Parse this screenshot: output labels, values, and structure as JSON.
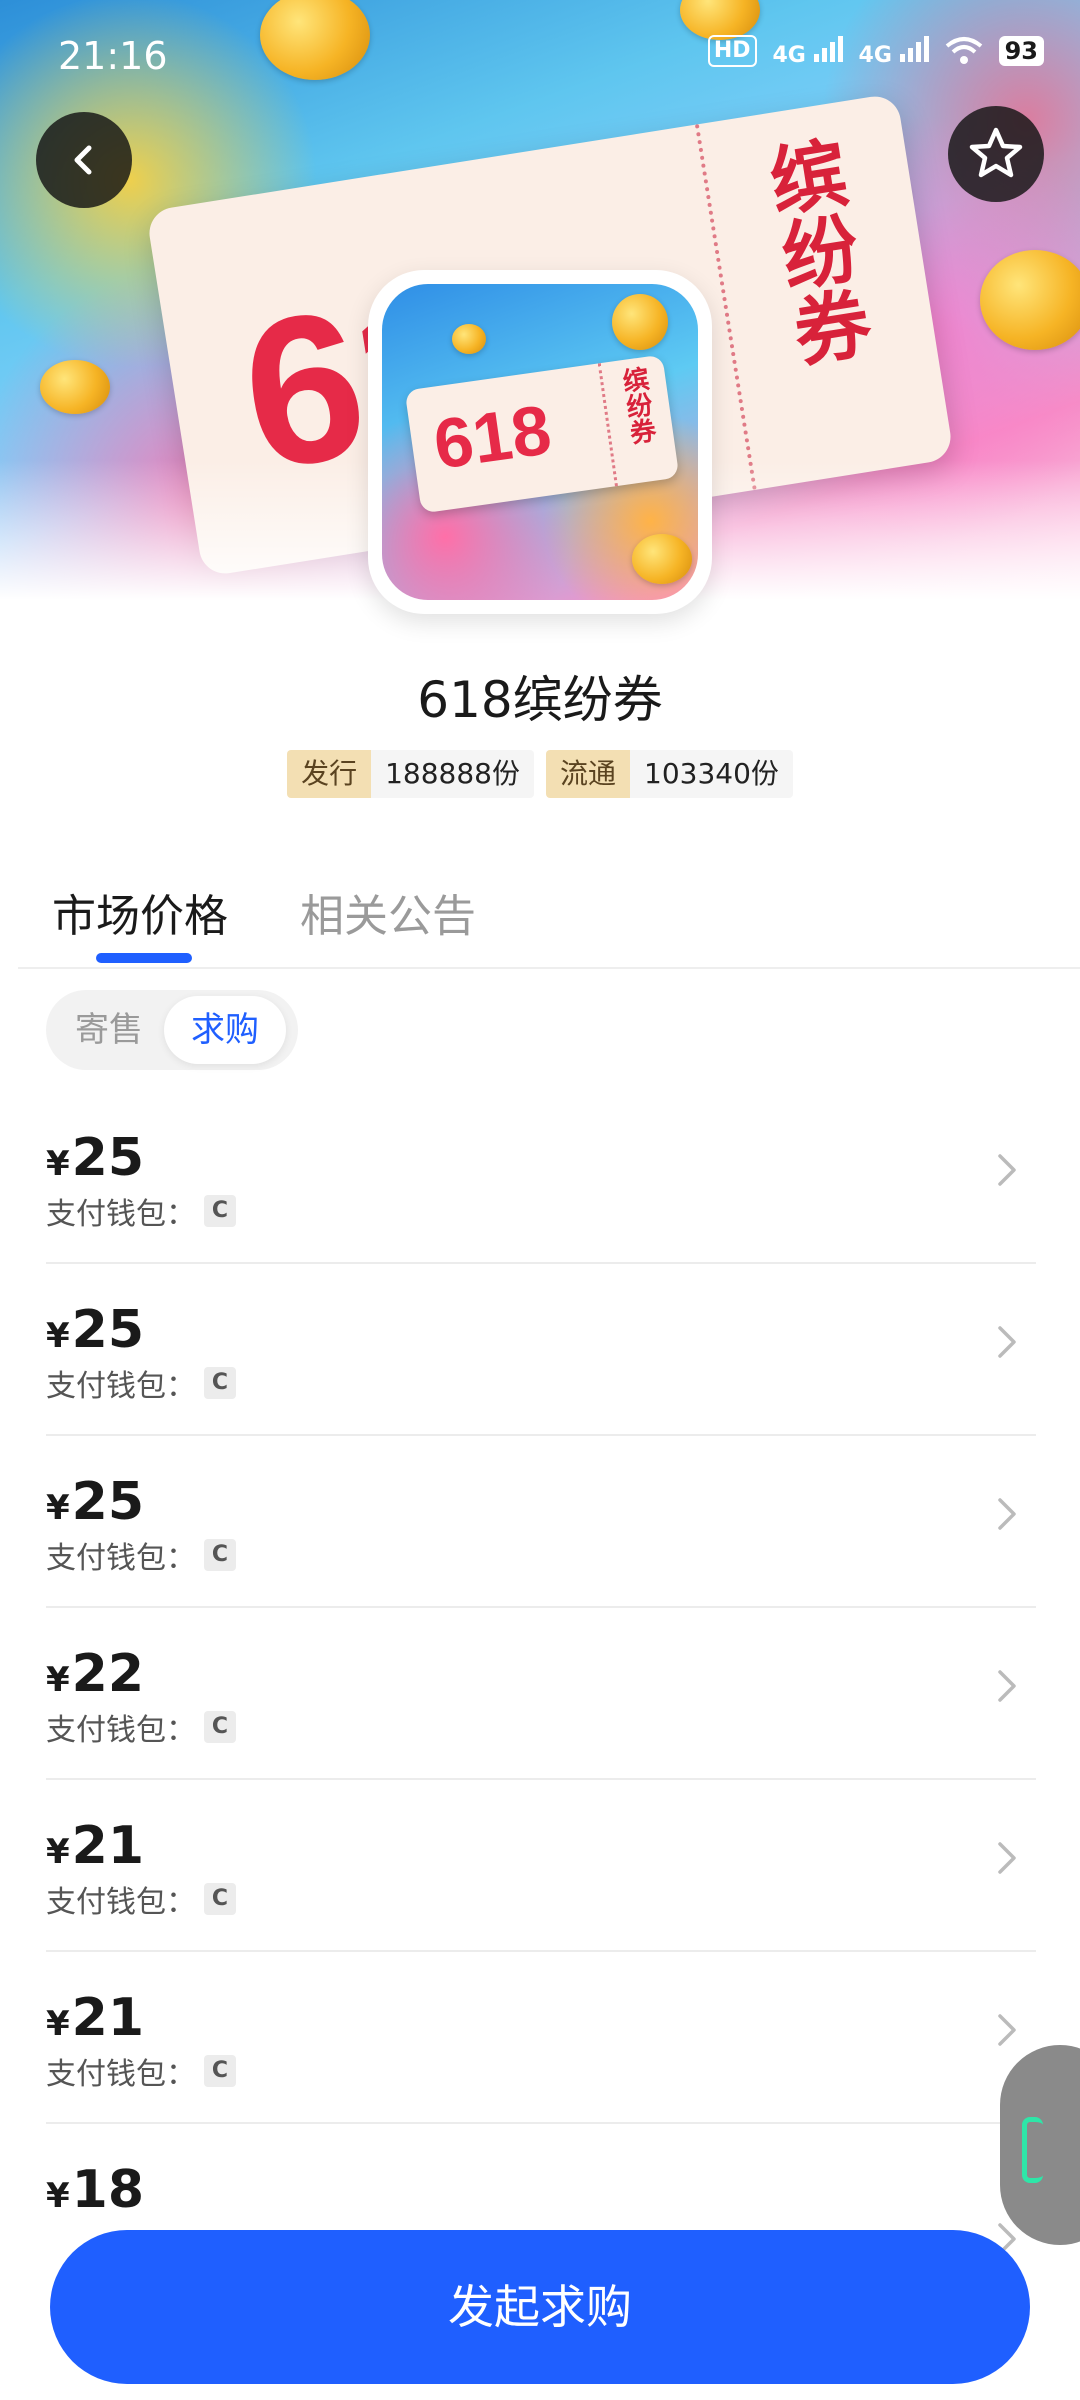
{
  "status_bar": {
    "time": "21:16",
    "hd_label": "HD",
    "net1": "4G",
    "net2": "4G",
    "battery": "93"
  },
  "hero": {
    "ticket_number": "618",
    "ticket_stub_text": "缤纷券"
  },
  "logo": {
    "ticket_number": "618",
    "stub_text": "缤纷券"
  },
  "product": {
    "title": "618缤纷券",
    "badges": [
      {
        "key": "发行",
        "value": "188888份"
      },
      {
        "key": "流通",
        "value": "103340份"
      }
    ]
  },
  "tabs": [
    {
      "label": "市场价格",
      "active": true
    },
    {
      "label": "相关公告",
      "active": false
    }
  ],
  "segment": {
    "options": [
      "寄售",
      "求购"
    ],
    "selected": "求购"
  },
  "listings": [
    {
      "currency": "¥",
      "price": "25",
      "wallet_label": "支付钱包：",
      "wallet_chip": "C"
    },
    {
      "currency": "¥",
      "price": "25",
      "wallet_label": "支付钱包：",
      "wallet_chip": "C"
    },
    {
      "currency": "¥",
      "price": "25",
      "wallet_label": "支付钱包：",
      "wallet_chip": "C"
    },
    {
      "currency": "¥",
      "price": "22",
      "wallet_label": "支付钱包：",
      "wallet_chip": "C"
    },
    {
      "currency": "¥",
      "price": "21",
      "wallet_label": "支付钱包：",
      "wallet_chip": "C"
    },
    {
      "currency": "¥",
      "price": "21",
      "wallet_label": "支付钱包：",
      "wallet_chip": "C"
    },
    {
      "currency": "¥",
      "price": "18"
    }
  ],
  "cta": {
    "label": "发起求购"
  },
  "colors": {
    "accent": "#1f5fff",
    "badge_key_bg": "#f3dfb3"
  },
  "icons": {
    "back": "back-arrow-icon",
    "favorite": "star-outline-icon",
    "row": "chevron-right-icon"
  }
}
